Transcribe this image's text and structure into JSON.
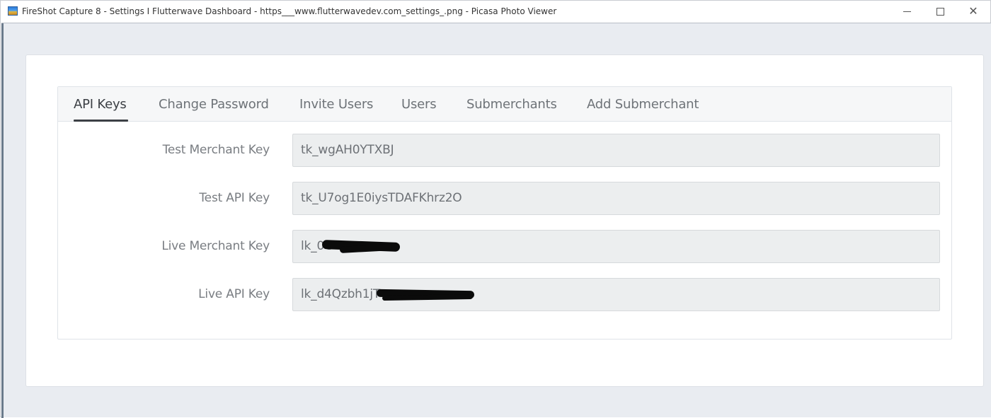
{
  "window": {
    "title": "FireShot Capture 8 - Settings I Flutterwave Dashboard - https___www.flutterwavedev.com_settings_.png - Picasa Photo Viewer",
    "app_icon": "picasa-photo-viewer-icon",
    "controls": {
      "minimize": "minimize-icon",
      "maximize": "maximize-icon",
      "close": "close-icon"
    }
  },
  "settings": {
    "tabs": [
      {
        "label": "API Keys",
        "active": true
      },
      {
        "label": "Change Password",
        "active": false
      },
      {
        "label": "Invite Users",
        "active": false
      },
      {
        "label": "Users",
        "active": false
      },
      {
        "label": "Submerchants",
        "active": false
      },
      {
        "label": "Add Submerchant",
        "active": false
      }
    ],
    "fields": [
      {
        "label": "Test Merchant Key",
        "value": "tk_wgAH0YTXBJ"
      },
      {
        "label": "Test API Key",
        "value": "tk_U7og1E0iysTDAFKhrz2O"
      },
      {
        "label": "Live Merchant Key",
        "value": "lk_0C",
        "redacted": true
      },
      {
        "label": "Live API Key",
        "value": "lk_d4Qzbh1jT",
        "redacted": true
      }
    ]
  },
  "colors": {
    "background": "#e9ecf1",
    "active_tab": "#3c4045",
    "inactive_tab": "#6e7378",
    "field_bg": "#eceeef"
  }
}
